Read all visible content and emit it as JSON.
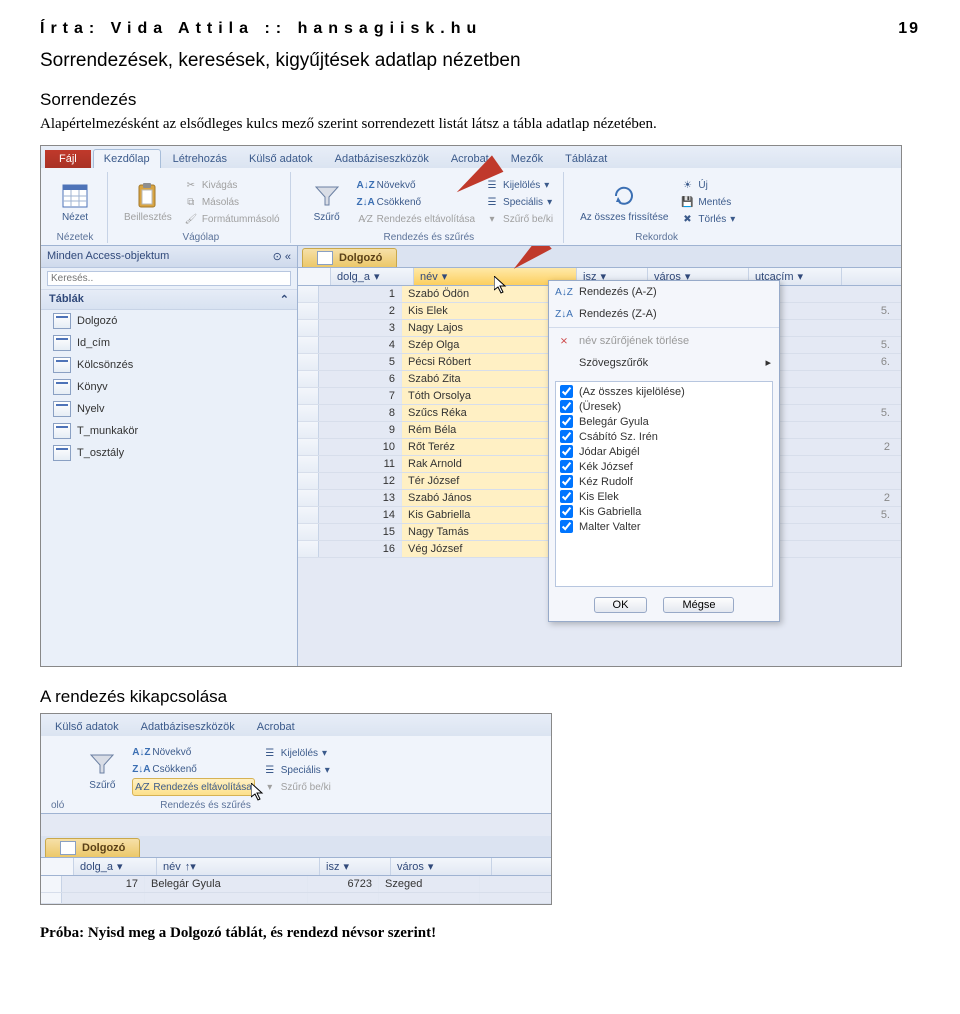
{
  "header": {
    "author_line": "Írta: Vida Attila :: hansagiisk.hu",
    "page_number": "19"
  },
  "section_title": "Sorrendezések, keresések, kigyűjtések adatlap nézetben",
  "subsection_title": "Sorrendezés",
  "body_paragraph": "Alapértelmezésként az elsődleges kulcs mező szerint sorrendezett listát látsz a tábla adatlap nézetében.",
  "shot1": {
    "ribbon_tabs": {
      "file": "Fájl",
      "home": "Kezdőlap",
      "create": "Létrehozás",
      "external": "Külső adatok",
      "dbtools": "Adatbáziseszközök",
      "acrobat": "Acrobat",
      "fields": "Mezők",
      "table": "Táblázat"
    },
    "groups": {
      "views": {
        "btn": "Nézet",
        "label": "Nézetek"
      },
      "clipboard": {
        "paste": "Beillesztés",
        "cut": "Kivágás",
        "copy": "Másolás",
        "fmt": "Formátummásoló",
        "label": "Vágólap"
      },
      "sortfilter": {
        "filter": "Szűrő",
        "asc": "Növekvő",
        "desc": "Csökkenő",
        "remove_sort": "Rendezés eltávolítása",
        "selection": "Kijelölés",
        "advanced": "Speciális",
        "toggle": "Szűrő be/ki",
        "label": "Rendezés és szűrés"
      },
      "records": {
        "refresh": "Az összes frissítése",
        "new": "Új",
        "save": "Mentés",
        "delete": "Törlés",
        "label": "Rekordok"
      }
    },
    "nav": {
      "header": "Minden Access-objektum",
      "search_placeholder": "Keresés..",
      "category": "Táblák",
      "items": [
        "Dolgozó",
        "Id_cím",
        "Kölcsönzés",
        "Könyv",
        "Nyelv",
        "T_munkakör",
        "T_osztály"
      ]
    },
    "doc_tab": "Dolgozó",
    "columns": {
      "id": "dolg_a",
      "name": "név",
      "isz": "isz",
      "city": "város",
      "street": "utcacím"
    },
    "rows": [
      {
        "id": "1",
        "name": "Szabó Ödön"
      },
      {
        "id": "2",
        "name": "Kis Elek",
        "tail": "5."
      },
      {
        "id": "3",
        "name": "Nagy Lajos"
      },
      {
        "id": "4",
        "name": "Szép Olga",
        "tail": "5."
      },
      {
        "id": "5",
        "name": "Pécsi Róbert",
        "tail": "6."
      },
      {
        "id": "6",
        "name": "Szabó Zita"
      },
      {
        "id": "7",
        "name": "Tóth Orsolya"
      },
      {
        "id": "8",
        "name": "Szűcs Réka",
        "tail": "5."
      },
      {
        "id": "9",
        "name": "Rém Béla"
      },
      {
        "id": "10",
        "name": "Rőt Teréz",
        "tail": "2"
      },
      {
        "id": "11",
        "name": "Rak Arnold"
      },
      {
        "id": "12",
        "name": "Tér József"
      },
      {
        "id": "13",
        "name": "Szabó János",
        "tail": "2"
      },
      {
        "id": "14",
        "name": "Kis Gabriella",
        "tail": "5."
      },
      {
        "id": "15",
        "name": "Nagy Tamás"
      },
      {
        "id": "16",
        "name": "Vég József"
      }
    ],
    "context_menu": {
      "sort_asc": "Rendezés (A-Z)",
      "sort_desc": "Rendezés (Z-A)",
      "clear_filter": "név szűrőjének törlése",
      "text_filters": "Szövegszűrők",
      "select_all": "(Az összes kijelölése)",
      "blanks": "(Üresek)",
      "values": [
        "Belegár Gyula",
        "Csábító Sz. Irén",
        "Jódar Abigél",
        "Kék József",
        "Kéz Rudolf",
        "Kis Elek",
        "Kis Gabriella",
        "Malter Valter"
      ],
      "ok": "OK",
      "cancel": "Mégse"
    }
  },
  "mid_heading": "A rendezés kikapcsolása",
  "shot2": {
    "ribbon_tabs": {
      "external": "Külső adatok",
      "dbtools": "Adatbáziseszközök",
      "acrobat": "Acrobat"
    },
    "groups": {
      "sortfilter": {
        "filter": "Szűrő",
        "asc": "Növekvő",
        "desc": "Csökkenő",
        "remove_sort": "Rendezés eltávolítása",
        "selection": "Kijelölés",
        "advanced": "Speciális",
        "toggle": "Szűrő be/ki",
        "label": "Rendezés és szűrés"
      }
    },
    "left_label": "oló",
    "doc_tab": "Dolgozó",
    "columns": {
      "id": "dolg_a",
      "name": "név",
      "isz": "isz",
      "city": "város"
    },
    "row": {
      "id": "17",
      "name": "Belegár Gyula",
      "isz": "6723",
      "city": "Szeged"
    }
  },
  "task_text": "Próba: Nyisd meg a Dolgozó táblát, és rendezd névsor szerint!"
}
